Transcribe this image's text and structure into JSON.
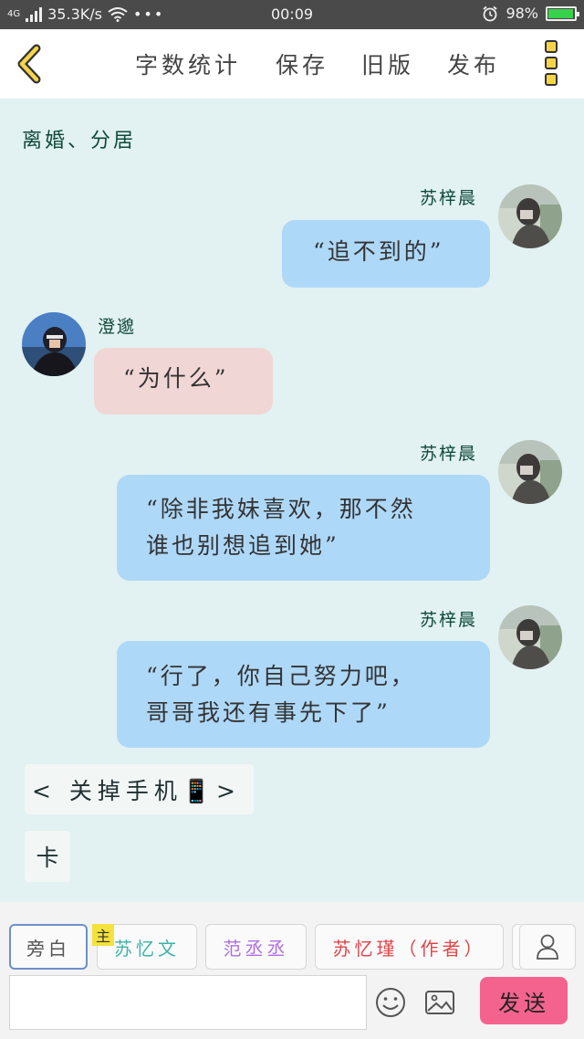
{
  "status_bar": {
    "network": "4G",
    "speed": "35.3K/s",
    "dots": "•••",
    "time": "00:09",
    "battery": "98%",
    "battery_level": 0.98
  },
  "toolbar": {
    "word_count": "字数统计",
    "save": "保存",
    "old_version": "旧版",
    "publish": "发布"
  },
  "chapter_title": "离婚、分居",
  "messages": [
    {
      "name": "苏梓晨",
      "line1": "“追不到的”",
      "line2": ""
    },
    {
      "name": "澄邈",
      "line1": "“为什么”",
      "line2": ""
    },
    {
      "name": "苏梓晨",
      "line1": "“除非我妹喜欢，那不然",
      "line2": "谁也别想追到她”"
    },
    {
      "name": "苏梓晨",
      "line1": "“行了，你自己努力吧，",
      "line2": "哥哥我还有事先下了”"
    }
  ],
  "narrations": {
    "phone_off": "< 关掉手机📱>",
    "card": "卡"
  },
  "roles": {
    "narrator": "旁白",
    "main_tag": "主",
    "su_yiwen": "苏忆文",
    "fan_chengcheng": "范丞丞",
    "su_yijin": "苏忆瑾（作者）"
  },
  "role_colors": {
    "su_yiwen": "#3fb2a8",
    "fan_chengcheng": "#b16fe0",
    "su_yijin": "#e0454a"
  },
  "input": {
    "value": "",
    "placeholder": ""
  },
  "send_label": "发送",
  "icons": [
    "back-icon",
    "more-icon",
    "person-icon",
    "emoji-icon",
    "image-icon"
  ]
}
